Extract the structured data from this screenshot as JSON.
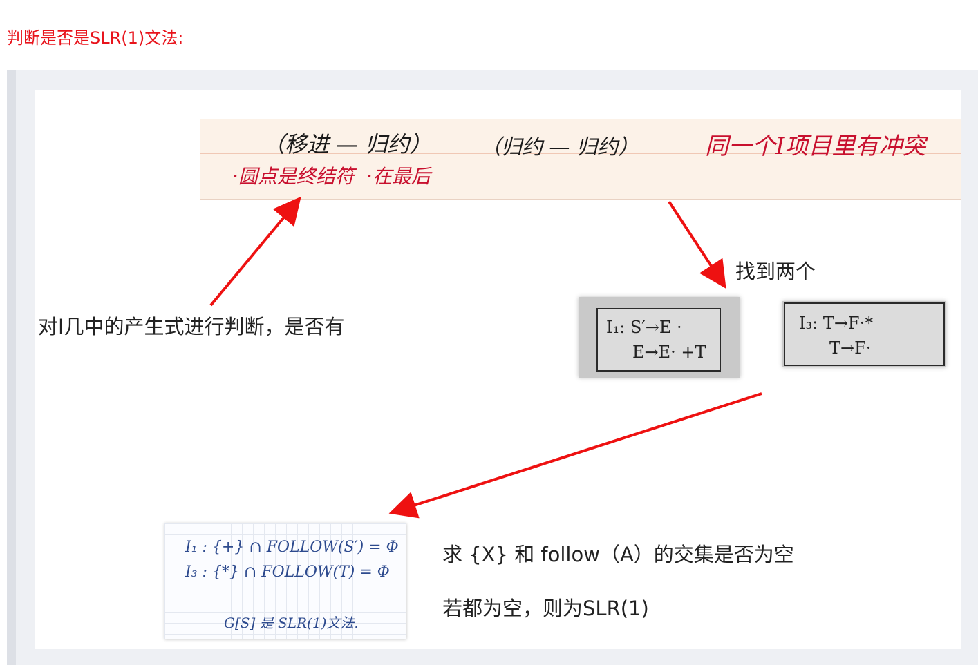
{
  "heading": "判断是否是SLR(1)文法:",
  "note": {
    "shift_reduce": "（移进 — 归约）",
    "reduce_reduce": "（归约 — 归约）",
    "conflict": "同一个I项目里有冲突",
    "cond1": "·圆点是终结符",
    "cond2": "·在最后"
  },
  "labels": {
    "left_caption": "对I几中的产生式进行判断，是否有",
    "found_two": "找到两个",
    "intersection": "求 {X} 和  follow（A）的交集是否为空",
    "conclusion": "若都为空，则为SLR(1)"
  },
  "state_i1": {
    "line1": "I₁: S′→E ·",
    "line2": "E→E· +T"
  },
  "state_i3": {
    "line1": "I₃: T→F·*",
    "line2": "T→F·"
  },
  "paper": {
    "line1": "I₁ :  {+} ∩ FOLLOW(S′) = Φ",
    "line2": "I₃ :  {*} ∩ FOLLOW(T) = Φ",
    "line3": "G[S] 是 SLR(1)文法."
  },
  "colors": {
    "heading": "#e8131b",
    "arrow": "#ee1111",
    "handwriting_red": "#c8102e"
  }
}
